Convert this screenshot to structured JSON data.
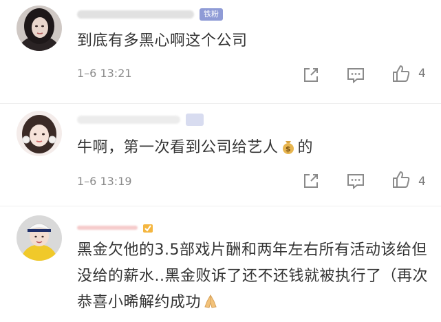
{
  "comments": [
    {
      "badge": "铁粉",
      "text": "到底有多黑心啊这个公司",
      "time": "1–6 13:21",
      "likes": "4"
    },
    {
      "text_before": "牛啊，第一次看到公司给艺人",
      "text_after": "的",
      "time": "1–6 13:19",
      "likes": "4"
    },
    {
      "text": "黑金欠他的3.5部戏片酬和两年左右所有活动该给但没给的薪水..黑金败诉了还不还钱就被执行了（再次恭喜小晞解约成功"
    }
  ],
  "icons": {
    "share": "share-icon",
    "comment": "comment-icon",
    "like": "thumbs-up-icon",
    "money": "money-bag-emoji",
    "clap": "praying-hands-emoji",
    "gold": "gold-member-icon"
  }
}
